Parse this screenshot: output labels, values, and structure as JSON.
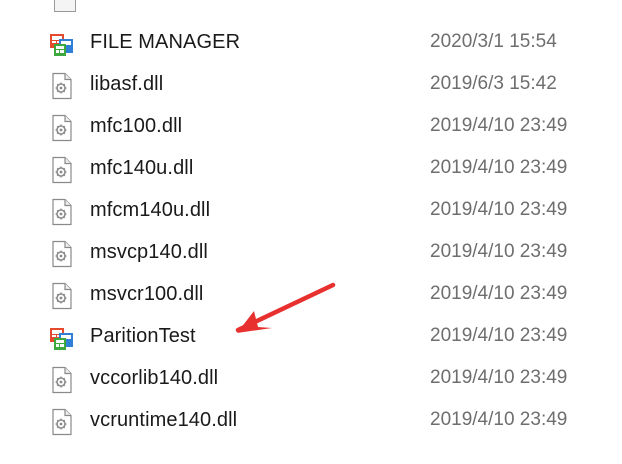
{
  "colors": {
    "date_text": "#6e6e6e",
    "name_text": "#1a1a1a",
    "arrow": "#e8302f"
  },
  "files": [
    {
      "name": "FILE MANAGER",
      "modified": "2020/3/1 15:54",
      "icon": "application-icon"
    },
    {
      "name": "libasf.dll",
      "modified": "2019/6/3 15:42",
      "icon": "dll-file-icon"
    },
    {
      "name": "mfc100.dll",
      "modified": "2019/4/10 23:49",
      "icon": "dll-file-icon"
    },
    {
      "name": "mfc140u.dll",
      "modified": "2019/4/10 23:49",
      "icon": "dll-file-icon"
    },
    {
      "name": "mfcm140u.dll",
      "modified": "2019/4/10 23:49",
      "icon": "dll-file-icon"
    },
    {
      "name": "msvcp140.dll",
      "modified": "2019/4/10 23:49",
      "icon": "dll-file-icon"
    },
    {
      "name": "msvcr100.dll",
      "modified": "2019/4/10 23:49",
      "icon": "dll-file-icon"
    },
    {
      "name": "ParitionTest",
      "modified": "2019/4/10 23:49",
      "icon": "application-icon"
    },
    {
      "name": "vccorlib140.dll",
      "modified": "2019/4/10 23:49",
      "icon": "dll-file-icon"
    },
    {
      "name": "vcruntime140.dll",
      "modified": "2019/4/10 23:49",
      "icon": "dll-file-icon"
    }
  ],
  "annotation": {
    "icon": "red-arrow-icon",
    "points_to": "ParitionTest"
  }
}
